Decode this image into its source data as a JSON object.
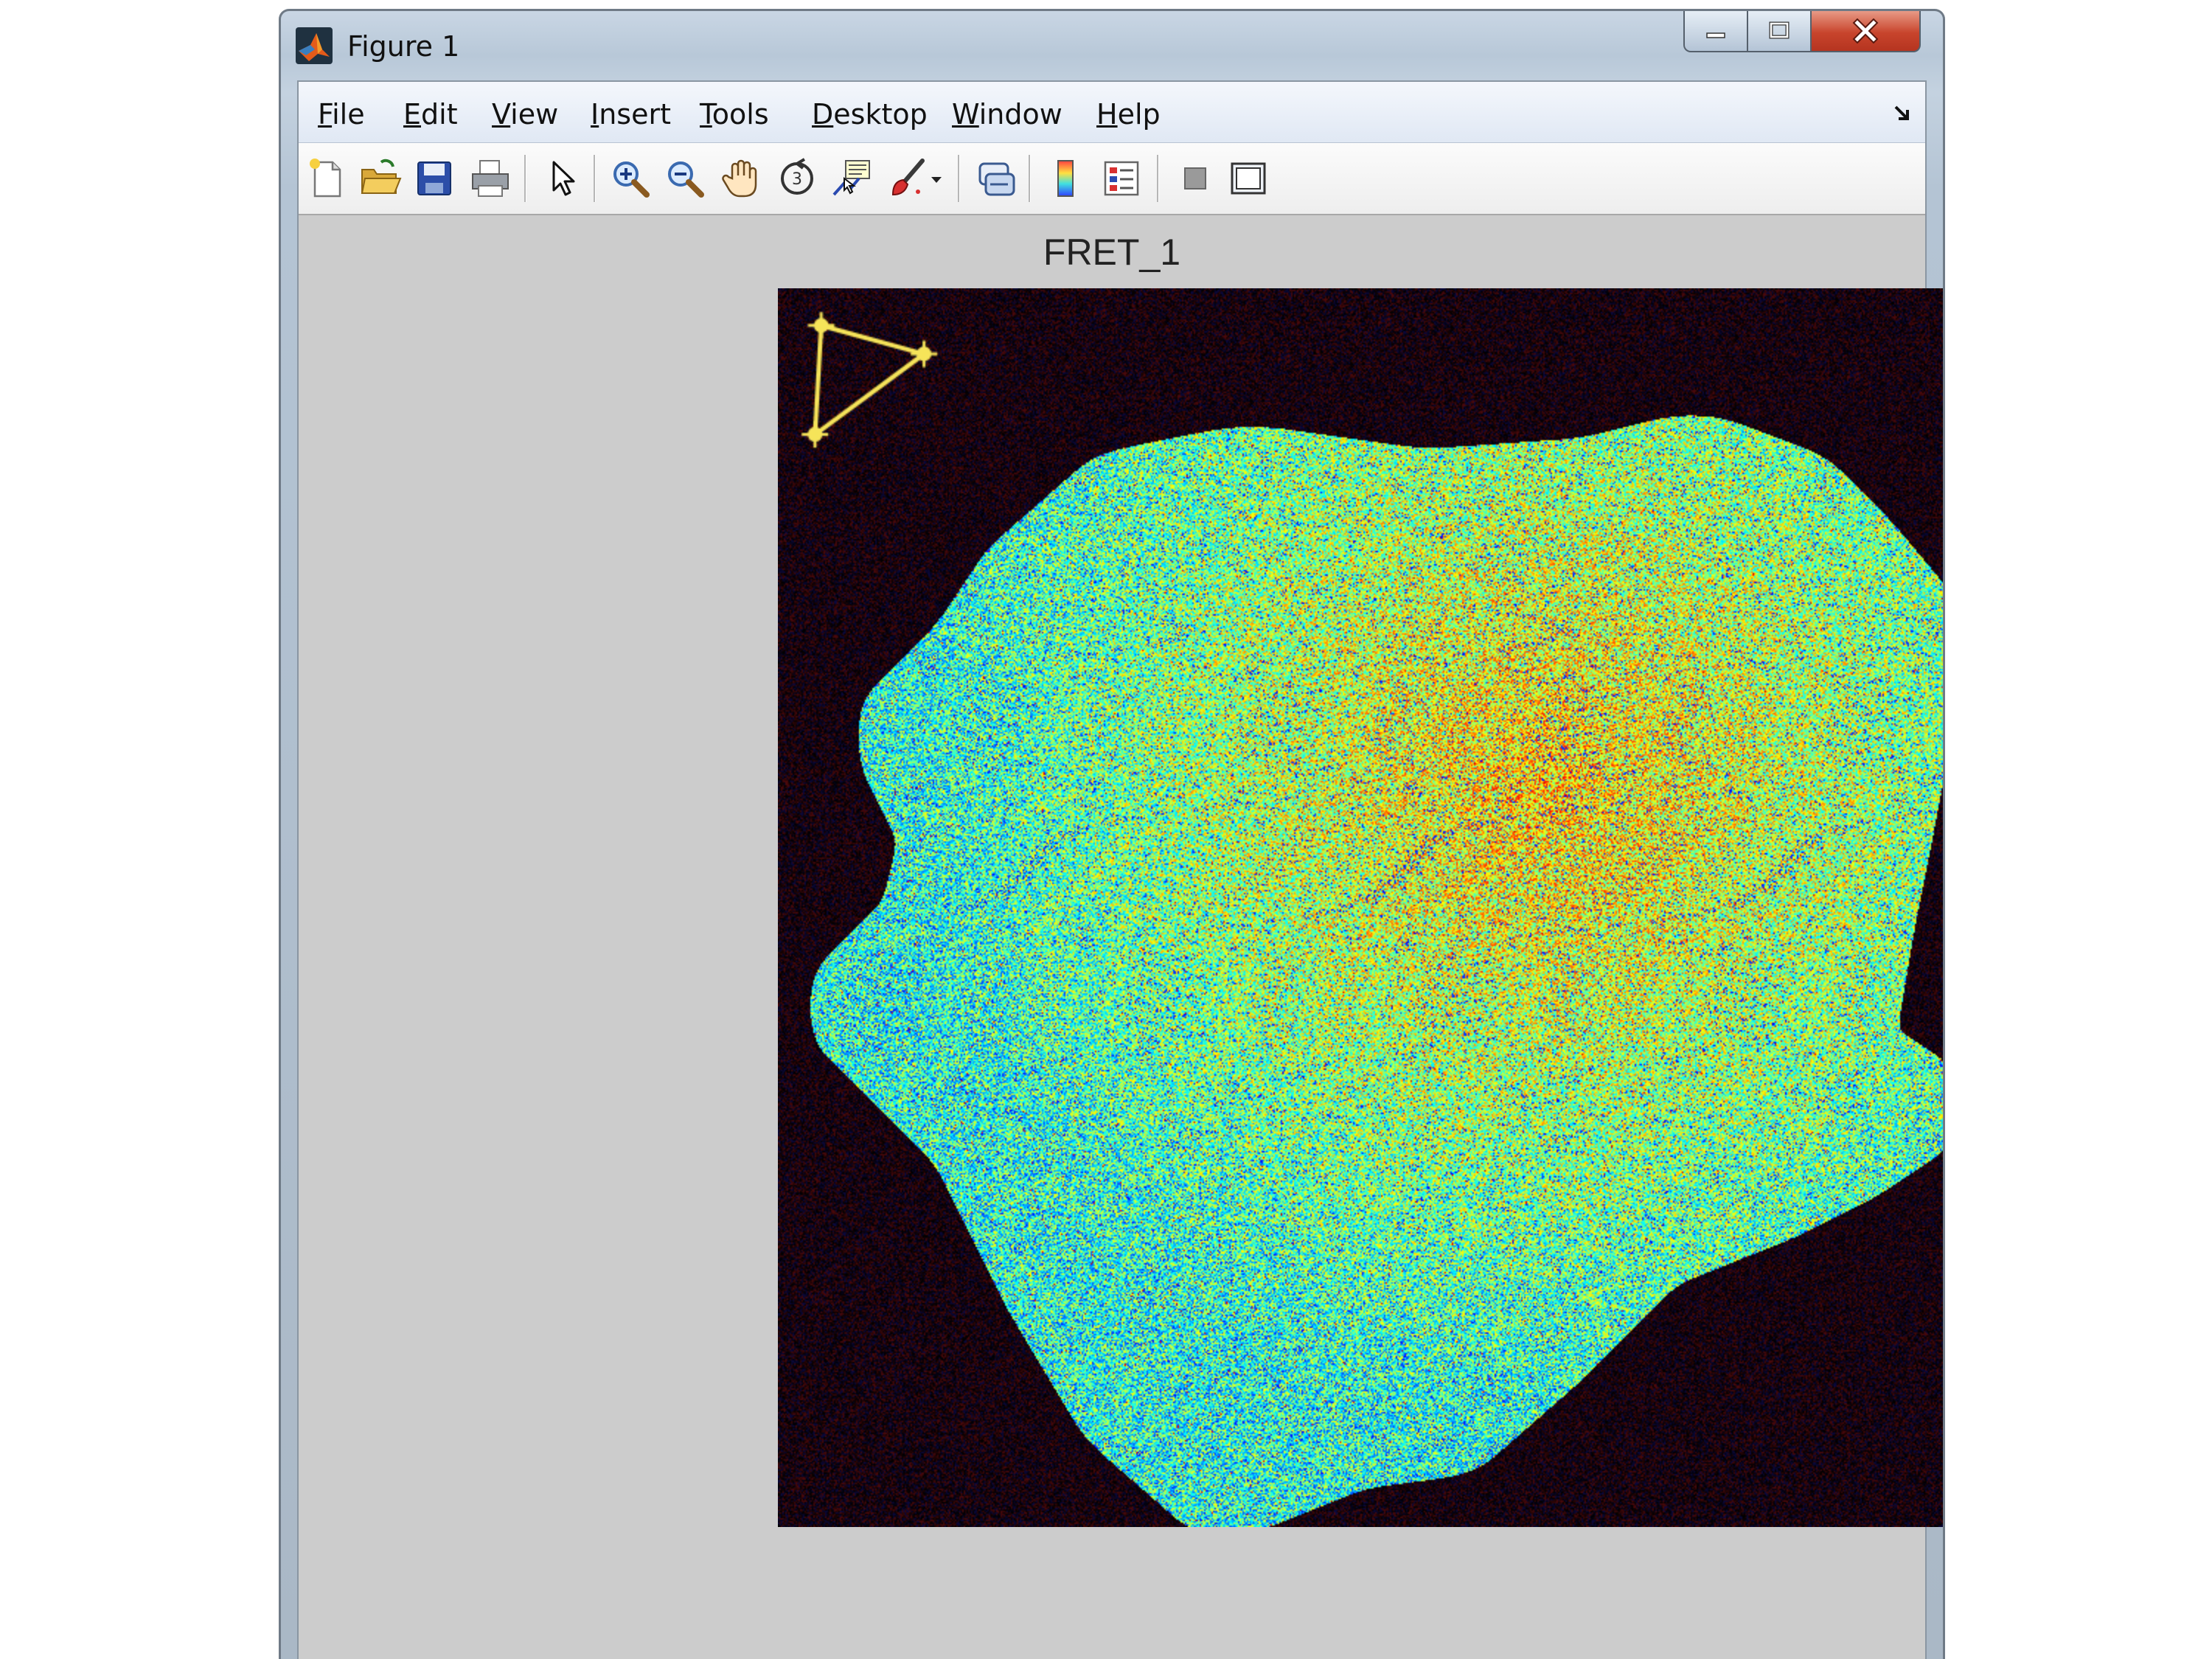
{
  "window": {
    "title": "Figure 1",
    "controls": {
      "minimize": "minimize-icon",
      "maximize": "maximize-icon",
      "close": "close-icon"
    }
  },
  "menu": {
    "items": [
      {
        "label": "File",
        "accel": "F"
      },
      {
        "label": "Edit",
        "accel": "E"
      },
      {
        "label": "View",
        "accel": "V"
      },
      {
        "label": "Insert",
        "accel": "I"
      },
      {
        "label": "Tools",
        "accel": "T"
      },
      {
        "label": "Desktop",
        "accel": "D"
      },
      {
        "label": "Window",
        "accel": "W"
      },
      {
        "label": "Help",
        "accel": "H"
      }
    ]
  },
  "toolbar": {
    "buttons": [
      "new-figure-icon",
      "open-file-icon",
      "save-icon",
      "print-icon",
      "pointer-icon",
      "zoom-in-icon",
      "zoom-out-icon",
      "pan-hand-icon",
      "rotate-3d-icon",
      "data-cursor-icon",
      "brush-icon",
      "dropdown-arrow-icon",
      "link-plot-icon",
      "colorbar-icon",
      "legend-icon",
      "hide-plot-tools-icon",
      "show-plot-tools-icon"
    ]
  },
  "axes": {
    "title": "FRET_1",
    "colormap": "jet",
    "background": "#000000",
    "roi": {
      "shape": "triangle",
      "color": "#f6e45a"
    }
  },
  "colors": {
    "window_frame": "#b8c8d8",
    "figure_background": "#cccccc",
    "close_button": "#c8442c"
  }
}
